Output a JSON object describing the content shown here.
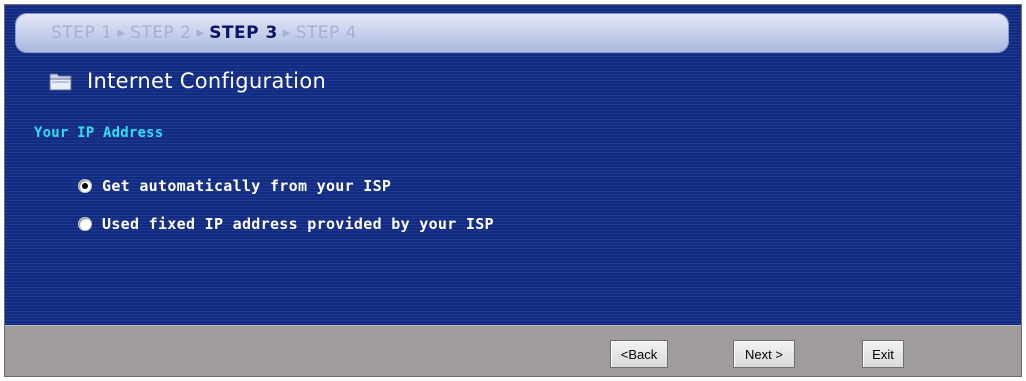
{
  "steps": [
    {
      "label": "STEP 1",
      "active": false
    },
    {
      "label": "STEP 2",
      "active": false
    },
    {
      "label": "STEP 3",
      "active": true
    },
    {
      "label": "STEP 4",
      "active": false
    }
  ],
  "step_separator": "▶",
  "title": "Internet Configuration",
  "section_title": "Your IP Address",
  "options": [
    {
      "label": "Get automatically from your ISP",
      "selected": true
    },
    {
      "label": "Used fixed IP address provided by your ISP",
      "selected": false
    }
  ],
  "buttons": {
    "back": "<Back",
    "next": "Next >",
    "exit": "Exit"
  },
  "icons": {
    "title_icon": "folder-icon"
  },
  "colors": {
    "background": "#16318a",
    "section_title": "#33ddee",
    "footer": "#a09c9c",
    "active_step": "#0a1464"
  }
}
